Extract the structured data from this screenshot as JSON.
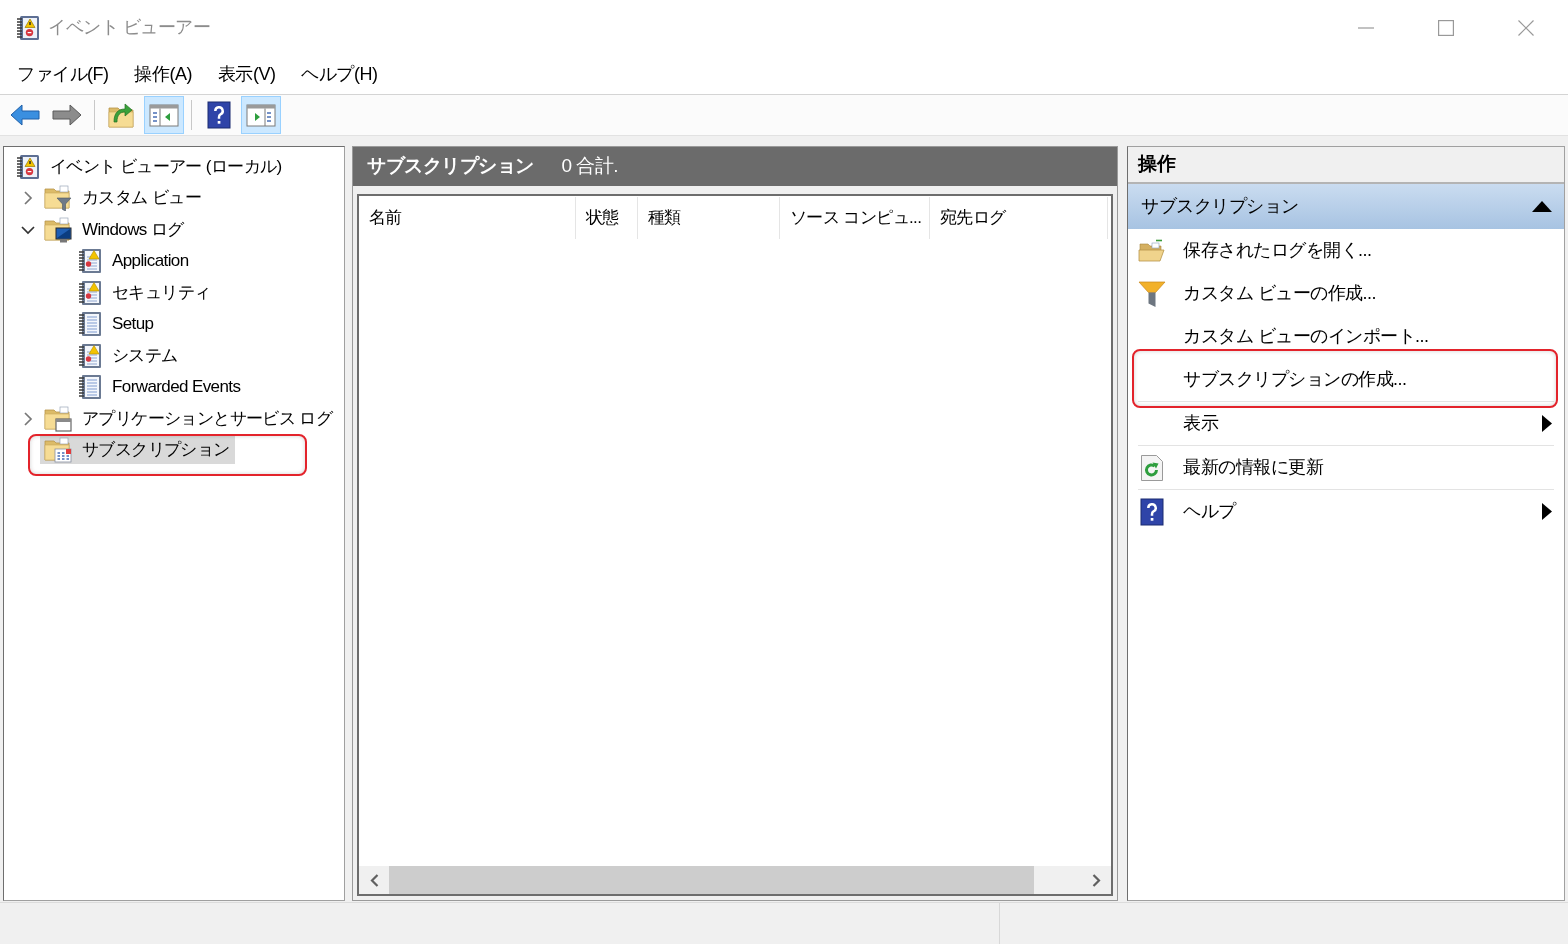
{
  "window": {
    "title": "イベント ビューアー"
  },
  "menu_bar": [
    "ファイル(F)",
    "操作(A)",
    "表示(V)",
    "ヘルプ(H)"
  ],
  "toolbar": [
    [
      {
        "kind": "back",
        "disabled": false,
        "pressed": false
      },
      {
        "kind": "forward",
        "disabled": true,
        "pressed": false
      }
    ],
    [
      {
        "kind": "up",
        "disabled": false,
        "pressed": false
      },
      {
        "kind": "console-tree",
        "disabled": false,
        "pressed": true
      }
    ],
    [
      {
        "kind": "help",
        "disabled": false,
        "pressed": false
      },
      {
        "kind": "action-pane",
        "disabled": false,
        "pressed": true
      }
    ]
  ],
  "tree": [
    {
      "label": "イベント ビューアー (ローカル)",
      "kind": "viewer",
      "selected": false,
      "highlighted": false,
      "children": [
        {
          "label": "カスタム ビュー",
          "kind": "folder-filter",
          "expanded": false,
          "selected": false,
          "highlighted": false
        },
        {
          "label": "Windows ログ",
          "kind": "folder-computer",
          "expanded": true,
          "selected": false,
          "highlighted": false,
          "children": [
            {
              "label": "Application",
              "kind": "log-alert",
              "selected": false,
              "highlighted": false
            },
            {
              "label": "セキュリティ",
              "kind": "log-alert",
              "selected": false,
              "highlighted": false
            },
            {
              "label": "Setup",
              "kind": "log-plain",
              "selected": false,
              "highlighted": false
            },
            {
              "label": "システム",
              "kind": "log-alert",
              "selected": false,
              "highlighted": false
            },
            {
              "label": "Forwarded Events",
              "kind": "log-plain",
              "selected": false,
              "highlighted": false
            }
          ]
        },
        {
          "label": "アプリケーションとサービス ログ",
          "kind": "folder-window",
          "expanded": false,
          "selected": false,
          "highlighted": false
        },
        {
          "label": "サブスクリプション",
          "kind": "folder-subscription",
          "selected": true,
          "highlighted": true
        }
      ]
    }
  ],
  "content": {
    "title": "サブスクリプション",
    "count": "0 合計.",
    "columns": [
      "名前",
      "状態",
      "種類",
      "ソース コンピュ...",
      "宛先ログ"
    ]
  },
  "actions": {
    "title": "操作",
    "section": {
      "title": "サブスクリプション",
      "expanded": true,
      "groups": [
        [
          {
            "label": "保存されたログを開く...",
            "kind": "open-folder",
            "submenu": false,
            "highlighted": false
          },
          {
            "label": "カスタム ビューの作成...",
            "kind": "filter",
            "submenu": false,
            "highlighted": false
          },
          {
            "label": "カスタム ビューのインポート...",
            "kind": "plain",
            "submenu": false,
            "highlighted": false
          },
          {
            "label": "サブスクリプションの作成...",
            "kind": "plain",
            "submenu": false,
            "highlighted": true
          }
        ],
        [
          {
            "label": "表示",
            "kind": "plain",
            "submenu": true,
            "highlighted": false
          }
        ],
        [
          {
            "label": "最新の情報に更新",
            "kind": "refresh",
            "submenu": false,
            "highlighted": false
          }
        ],
        [
          {
            "label": "ヘルプ",
            "kind": "help",
            "submenu": true,
            "highlighted": false
          }
        ]
      ]
    }
  }
}
